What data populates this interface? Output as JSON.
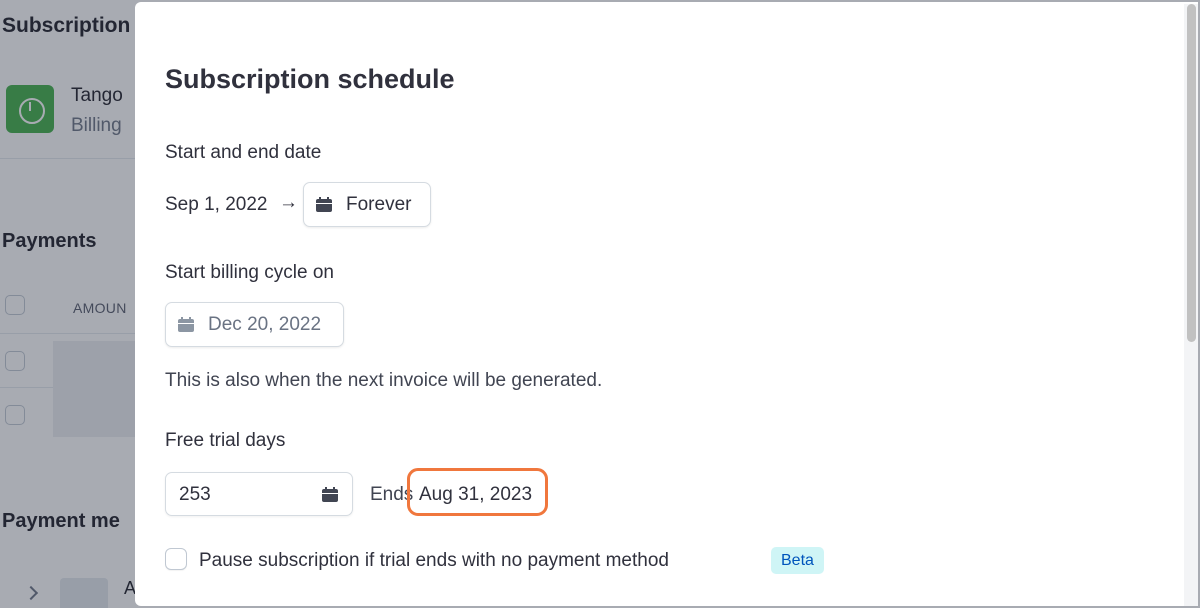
{
  "background": {
    "title": "Subscription",
    "customer_name": "Tango",
    "customer_sub": "Billing",
    "payments_heading": "Payments",
    "amount_header": "AMOUN",
    "payment_methods_heading": "Payment me",
    "bank_label": "A"
  },
  "modal": {
    "title": "Subscription schedule",
    "start_end": {
      "label": "Start and end date",
      "start_date": "Sep 1, 2022",
      "arrow": "→",
      "end_button": "Forever"
    },
    "billing_cycle": {
      "label": "Start billing cycle on",
      "date": "Dec 20, 2022",
      "helper": "This is also when the next invoice will be generated."
    },
    "trial": {
      "label": "Free trial days",
      "value": "253",
      "ends_label": "Ends",
      "ends_date": "Aug 31, 2023"
    },
    "pause": {
      "checked": false,
      "label": "Pause subscription if trial ends with no payment method",
      "badge": "Beta"
    }
  },
  "colors": {
    "highlight": "#f0773d",
    "badge_bg": "#cff5f6",
    "badge_text": "#0055bc",
    "logo": "#3fae46"
  }
}
